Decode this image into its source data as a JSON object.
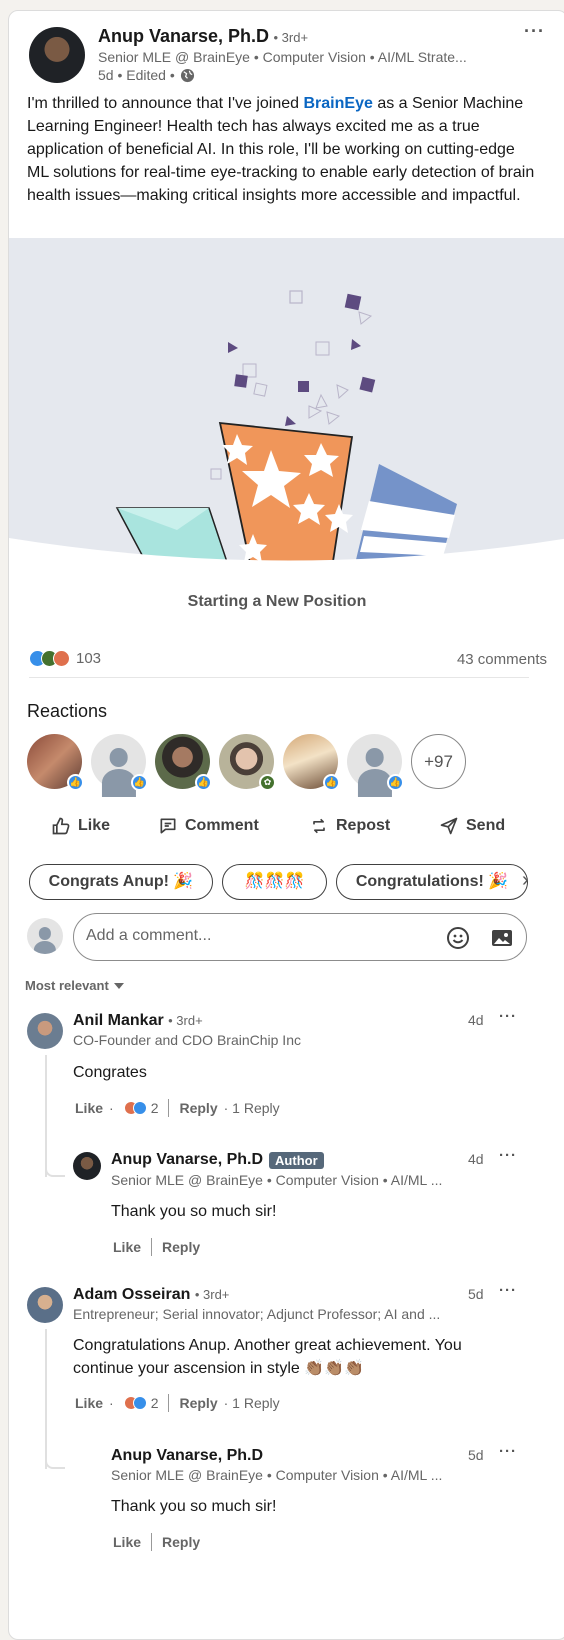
{
  "post": {
    "author_name": "Anup Vanarse, Ph.D",
    "author_degree": "• 3rd+",
    "author_headline": "Senior MLE @ BrainEye • Computer Vision • AI/ML Strate...",
    "meta": "5d • Edited •",
    "text_before": "I'm thrilled to announce that I've joined ",
    "text_link": "BrainEye",
    "text_after": " as a Senior Machine Learning Engineer! Health tech has always excited me as a true application of beneficial AI. In this role, I'll be working on cutting-edge ML solutions for real-time eye-tracking to enable early detection of brain health issues—making critical insights more accessible and impactful.",
    "image_caption": "Starting a New Position"
  },
  "social": {
    "reaction_count": "103",
    "comment_count": "43 comments"
  },
  "reactions": {
    "heading": "Reactions",
    "more_label": "+97"
  },
  "actions": {
    "like": "Like",
    "comment": "Comment",
    "repost": "Repost",
    "send": "Send"
  },
  "suggestions": [
    "Congrats Anup! 🎉",
    "🎊🎊🎊",
    "Congratulations! 🎉"
  ],
  "comment_box": {
    "placeholder": "Add a comment..."
  },
  "sort_label": "Most relevant",
  "comments": [
    {
      "name": "Anil Mankar",
      "degree": "• 3rd+",
      "headline": "CO-Founder and CDO BrainChip Inc",
      "time": "4d",
      "text": "Congrates",
      "like": "Like",
      "reaction_count": "2",
      "reply": "Reply",
      "reply_count": "· 1 Reply",
      "reply_item": {
        "name": "Anup Vanarse, Ph.D",
        "badge": "Author",
        "headline": "Senior MLE @ BrainEye • Computer Vision • AI/ML ...",
        "time": "4d",
        "text": "Thank you so much sir!",
        "like": "Like",
        "reply": "Reply"
      }
    },
    {
      "name": "Adam Osseiran",
      "degree": "• 3rd+",
      "headline": "Entrepreneur; Serial innovator; Adjunct Professor; AI and ...",
      "time": "5d",
      "text": "Congratulations Anup. Another great achievement. You continue your ascension in style 👏🏽👏🏽👏🏽",
      "like": "Like",
      "reaction_count": "2",
      "reply": "Reply",
      "reply_count": "· 1 Reply",
      "reply_item": {
        "name": "Anup Vanarse, Ph.D",
        "headline": "Senior MLE @ BrainEye • Computer Vision • AI/ML ...",
        "time": "5d",
        "text": "Thank you so much sir!",
        "like": "Like",
        "reply": "Reply"
      }
    }
  ],
  "colors": {
    "link": "#0a66c2",
    "like_blue": "#378fe9",
    "illustration_bg": "#e5e8ee",
    "orange": "#f0965a",
    "purple": "#5d4b80",
    "teal": "#a9e4de",
    "blue_stripe": "#7593c9"
  }
}
